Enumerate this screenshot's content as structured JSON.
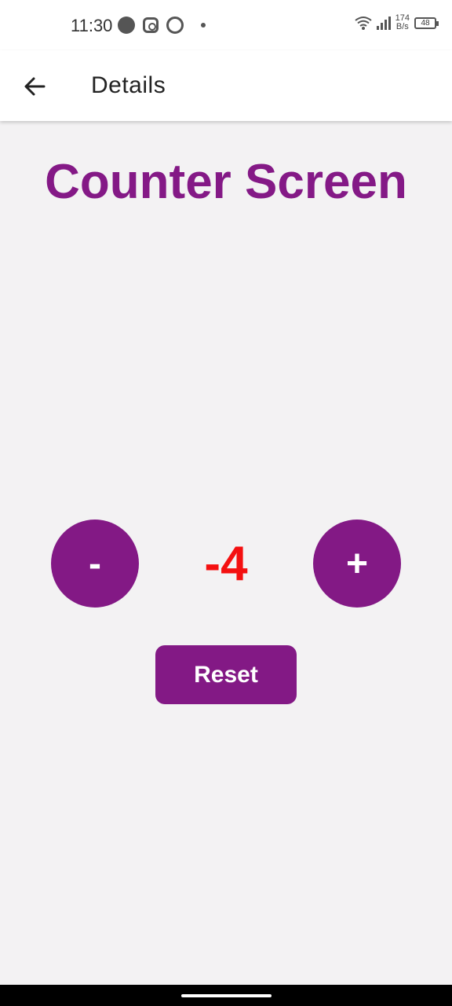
{
  "status_bar": {
    "time": "11:30",
    "left_icons": [
      "messenger-icon",
      "instagram-icon",
      "whatsapp-icon",
      "notification-dot-icon"
    ],
    "network_speed_value": "174",
    "network_speed_unit": "B/s",
    "battery_level": "48"
  },
  "app_bar": {
    "back_icon": "arrow-left-icon",
    "title": "Details"
  },
  "screen": {
    "heading": "Counter Screen",
    "decrement_label": "-",
    "counter_value": "-4",
    "increment_label": "+",
    "reset_label": "Reset"
  },
  "colors": {
    "accent_purple": "#831985",
    "counter_red": "#f41010",
    "background": "#f3f2f3"
  }
}
